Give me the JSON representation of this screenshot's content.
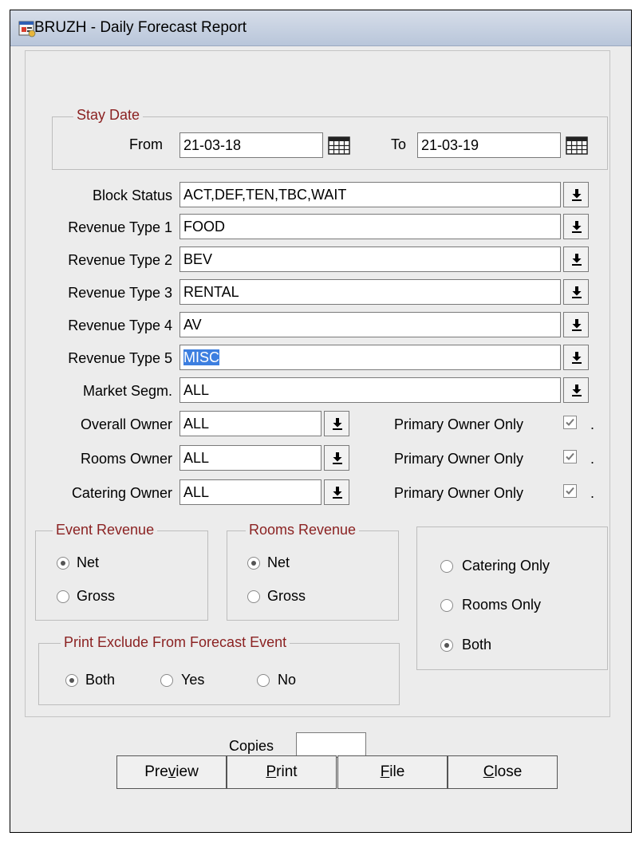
{
  "window": {
    "title": "BRUZH - Daily Forecast Report"
  },
  "stay_date": {
    "legend": "Stay Date",
    "from_label": "From",
    "from_value": "21-03-18",
    "to_label": "To",
    "to_value": "21-03-19"
  },
  "fields": [
    {
      "label": "Block Status",
      "value": "ACT,DEF,TEN,TBC,WAIT"
    },
    {
      "label": "Revenue Type 1",
      "value": "FOOD"
    },
    {
      "label": "Revenue Type 2",
      "value": "BEV"
    },
    {
      "label": "Revenue Type 3",
      "value": "RENTAL"
    },
    {
      "label": "Revenue Type 4",
      "value": "AV"
    },
    {
      "label": "Revenue Type 5",
      "value": "MISC"
    },
    {
      "label": "Market Segm.",
      "value": "ALL"
    }
  ],
  "owners": [
    {
      "label": "Overall Owner",
      "value": "ALL",
      "primary_label": "Primary Owner Only",
      "primary_checked": true
    },
    {
      "label": "Rooms Owner",
      "value": "ALL",
      "primary_label": "Primary Owner Only",
      "primary_checked": true
    },
    {
      "label": "Catering Owner",
      "value": "ALL",
      "primary_label": "Primary Owner Only",
      "primary_checked": true
    }
  ],
  "event_revenue": {
    "legend": "Event Revenue",
    "options": [
      "Net",
      "Gross"
    ],
    "selected": "Net"
  },
  "rooms_revenue": {
    "legend": "Rooms Revenue",
    "options": [
      "Net",
      "Gross"
    ],
    "selected": "Net"
  },
  "scope": {
    "options": [
      "Catering Only",
      "Rooms Only",
      "Both"
    ],
    "selected": "Both"
  },
  "print_exclude": {
    "legend": "Print Exclude From Forecast Event",
    "options": [
      "Both",
      "Yes",
      "No"
    ],
    "selected": "Both"
  },
  "copies": {
    "label": "Copies",
    "value": ""
  },
  "buttons": {
    "preview": {
      "pre": "Pre",
      "key": "v",
      "post": "iew"
    },
    "print": {
      "pre": "",
      "key": "P",
      "post": "rint"
    },
    "file": {
      "pre": "",
      "key": "F",
      "post": "ile"
    },
    "close": {
      "pre": "",
      "key": "C",
      "post": "lose"
    }
  },
  "icons": {
    "window": "report-window-icon",
    "calendar": "calendar-icon",
    "dropdown": "dropdown-arrow-icon",
    "check": "checkmark-icon"
  },
  "colors": {
    "legend_text": "#8b2222",
    "selection": "#3d7fe0",
    "titlebar": "#c5d0e2"
  }
}
